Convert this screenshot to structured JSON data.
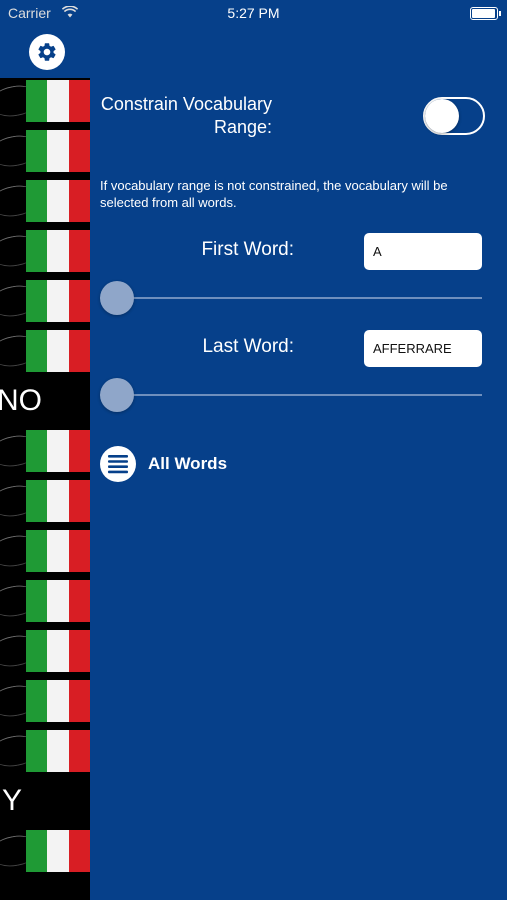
{
  "status_bar": {
    "carrier": "Carrier",
    "time": "5:27 PM",
    "battery_level": 0.95
  },
  "side_list": {
    "header_icon": "gear-icon",
    "section_letters": [
      "NO",
      "Y"
    ],
    "flag_colors": [
      "#1f9a35",
      "#f3f3f3",
      "#d81e24"
    ]
  },
  "settings": {
    "constrain_label": "Constrain Vocabulary Range:",
    "constrain_enabled": false,
    "note": "If vocabulary range is not constrained, the vocabulary will be selected from all words.",
    "first_word": {
      "label": "First Word:",
      "value": "A",
      "slider_position": 0
    },
    "last_word": {
      "label": "Last Word:",
      "value": "AFFERRARE",
      "slider_position": 0
    },
    "all_words": {
      "label": "All Words",
      "icon": "list-icon"
    }
  },
  "colors": {
    "panel_background": "#06408a",
    "accent_white": "#ffffff"
  }
}
